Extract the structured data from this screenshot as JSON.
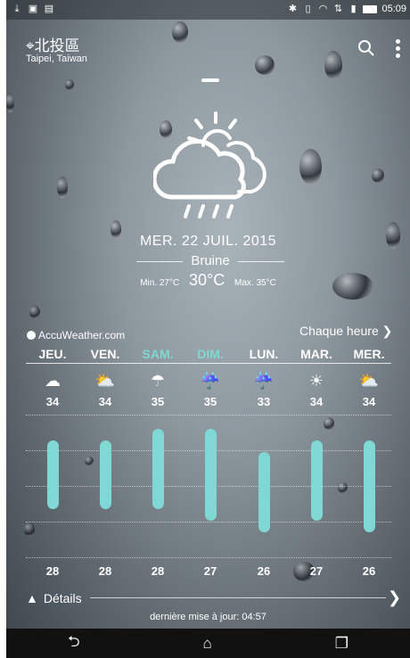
{
  "status_bar": {
    "time": "05:09"
  },
  "location": {
    "name": "北投區",
    "region": "Taipei, Taiwan"
  },
  "current": {
    "date": "MER. 22 JUIL. 2015",
    "condition": "Bruine",
    "min": "Min. 27°C",
    "temp": "30°C",
    "max": "Max. 35°C"
  },
  "provider": "AccuWeather.com",
  "hourly_link": "Chaque heure",
  "forecast": [
    {
      "day": "JEU.",
      "hi": 34,
      "lo": 28,
      "icon": "cloud-icon"
    },
    {
      "day": "VEN.",
      "hi": 34,
      "lo": 28,
      "icon": "partly-sunny-icon"
    },
    {
      "day": "SAM.",
      "hi": 35,
      "lo": 28,
      "icon": "rain-sun-icon"
    },
    {
      "day": "DIM.",
      "hi": 35,
      "lo": 27,
      "icon": "rain-icon"
    },
    {
      "day": "LUN.",
      "hi": 33,
      "lo": 26,
      "icon": "rain-icon"
    },
    {
      "day": "MAR.",
      "hi": 34,
      "lo": 27,
      "icon": "sun-icon"
    },
    {
      "day": "MER.",
      "hi": 34,
      "lo": 26,
      "icon": "cloud-sun-icon"
    }
  ],
  "details_label": "Détails",
  "updated": "dernière mise à jour: 04:57",
  "colors": {
    "accent": "#7fd8d3"
  }
}
